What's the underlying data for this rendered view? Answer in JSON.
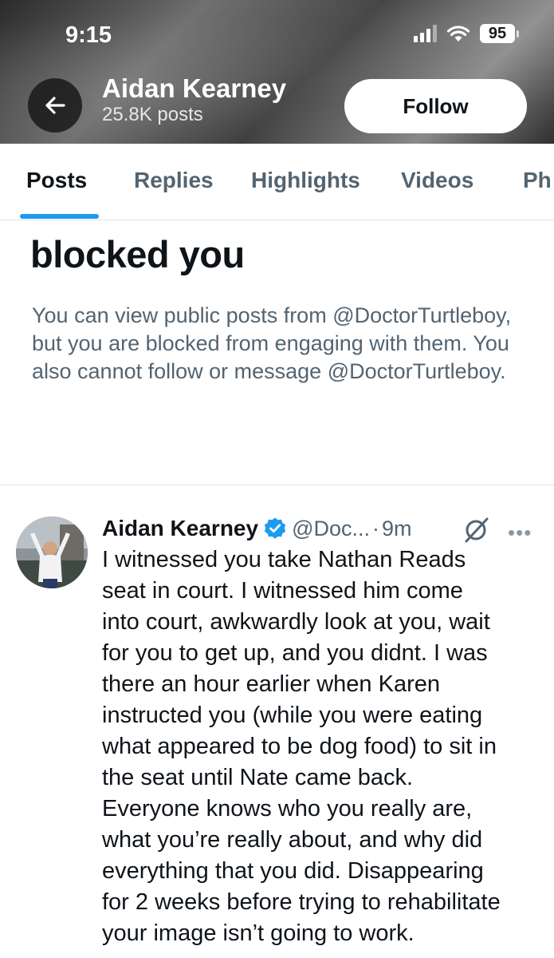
{
  "status_bar": {
    "time": "9:15",
    "battery": "95"
  },
  "header": {
    "back_icon": "arrow-left-icon",
    "name": "Aidan Kearney",
    "posts_count": "25.8K posts",
    "follow_label": "Follow"
  },
  "tabs": [
    {
      "label": "Posts",
      "active": true
    },
    {
      "label": "Replies",
      "active": false
    },
    {
      "label": "Highlights",
      "active": false
    },
    {
      "label": "Videos",
      "active": false
    },
    {
      "label": "Ph",
      "active": false
    }
  ],
  "blocked_notice": {
    "title": "blocked you",
    "description": "You can view public posts from @DoctorTurtleboy, but you are blocked from engaging with them. You also cannot follow or message @DoctorTurtleboy."
  },
  "tweet": {
    "author_name": "Aidan Kearney",
    "verified_icon": "verified-badge-icon",
    "handle": "@Doc...",
    "time": "9m",
    "text": "I witnessed you take Nathan Reads\nseat in court. I witnessed him come\ninto court, awkwardly look at you, wait\nfor you to get up, and you didnt. I was\nthere an hour earlier when Karen\ninstructed you (while you were eating\nwhat appeared to be dog food) to sit in\nthe seat until Nate came back.\nEveryone knows who you really are,\nwhat you’re really about, and why did\neverything that you did. Disappearing\nfor 2 weeks before trying to rehabilitate\nyour image isn’t going to work."
  },
  "colors": {
    "accent": "#1d9bf0",
    "text_primary": "#0f1419",
    "text_secondary": "#536471"
  }
}
